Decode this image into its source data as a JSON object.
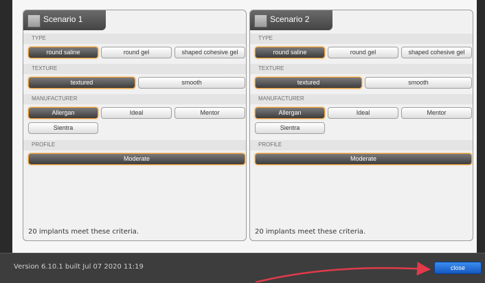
{
  "scenarios": [
    {
      "title": "Scenario 1",
      "sections": {
        "type": {
          "label": "TYPE",
          "options": [
            "round saline",
            "round gel",
            "shaped cohesive gel"
          ]
        },
        "texture": {
          "label": "TEXTURE",
          "options": [
            "textured",
            "smooth"
          ]
        },
        "manufacturer": {
          "label": "MANUFACTURER",
          "options": [
            "Allergan",
            "Ideal",
            "Mentor",
            "Sientra"
          ]
        },
        "profile": {
          "label": "PROFILE",
          "options": [
            "Moderate"
          ]
        }
      },
      "selected": {
        "type": "round saline",
        "texture": "textured",
        "manufacturer": "Allergan",
        "profile": "Moderate"
      },
      "criteria_text": "20 implants meet these criteria."
    },
    {
      "title": "Scenario 2",
      "sections": {
        "type": {
          "label": "TYPE",
          "options": [
            "round saline",
            "round gel",
            "shaped cohesive gel"
          ]
        },
        "texture": {
          "label": "TEXTURE",
          "options": [
            "textured",
            "smooth"
          ]
        },
        "manufacturer": {
          "label": "MANUFACTURER",
          "options": [
            "Allergan",
            "Ideal",
            "Mentor",
            "Sientra"
          ]
        },
        "profile": {
          "label": "PROFILE",
          "options": [
            "Moderate"
          ]
        }
      },
      "selected": {
        "type": "round saline",
        "texture": "textured",
        "manufacturer": "Allergan",
        "profile": "Moderate"
      },
      "criteria_text": "20 implants meet these criteria."
    }
  ],
  "footer": {
    "version_text": "Version 6.10.1 built Jul 07 2020 11:19",
    "close_label": "close"
  },
  "colors": {
    "accent_selected_border": "#e89a2c",
    "close_button": "#1f6fd8",
    "annotation_arrow": "#e23a4a"
  }
}
